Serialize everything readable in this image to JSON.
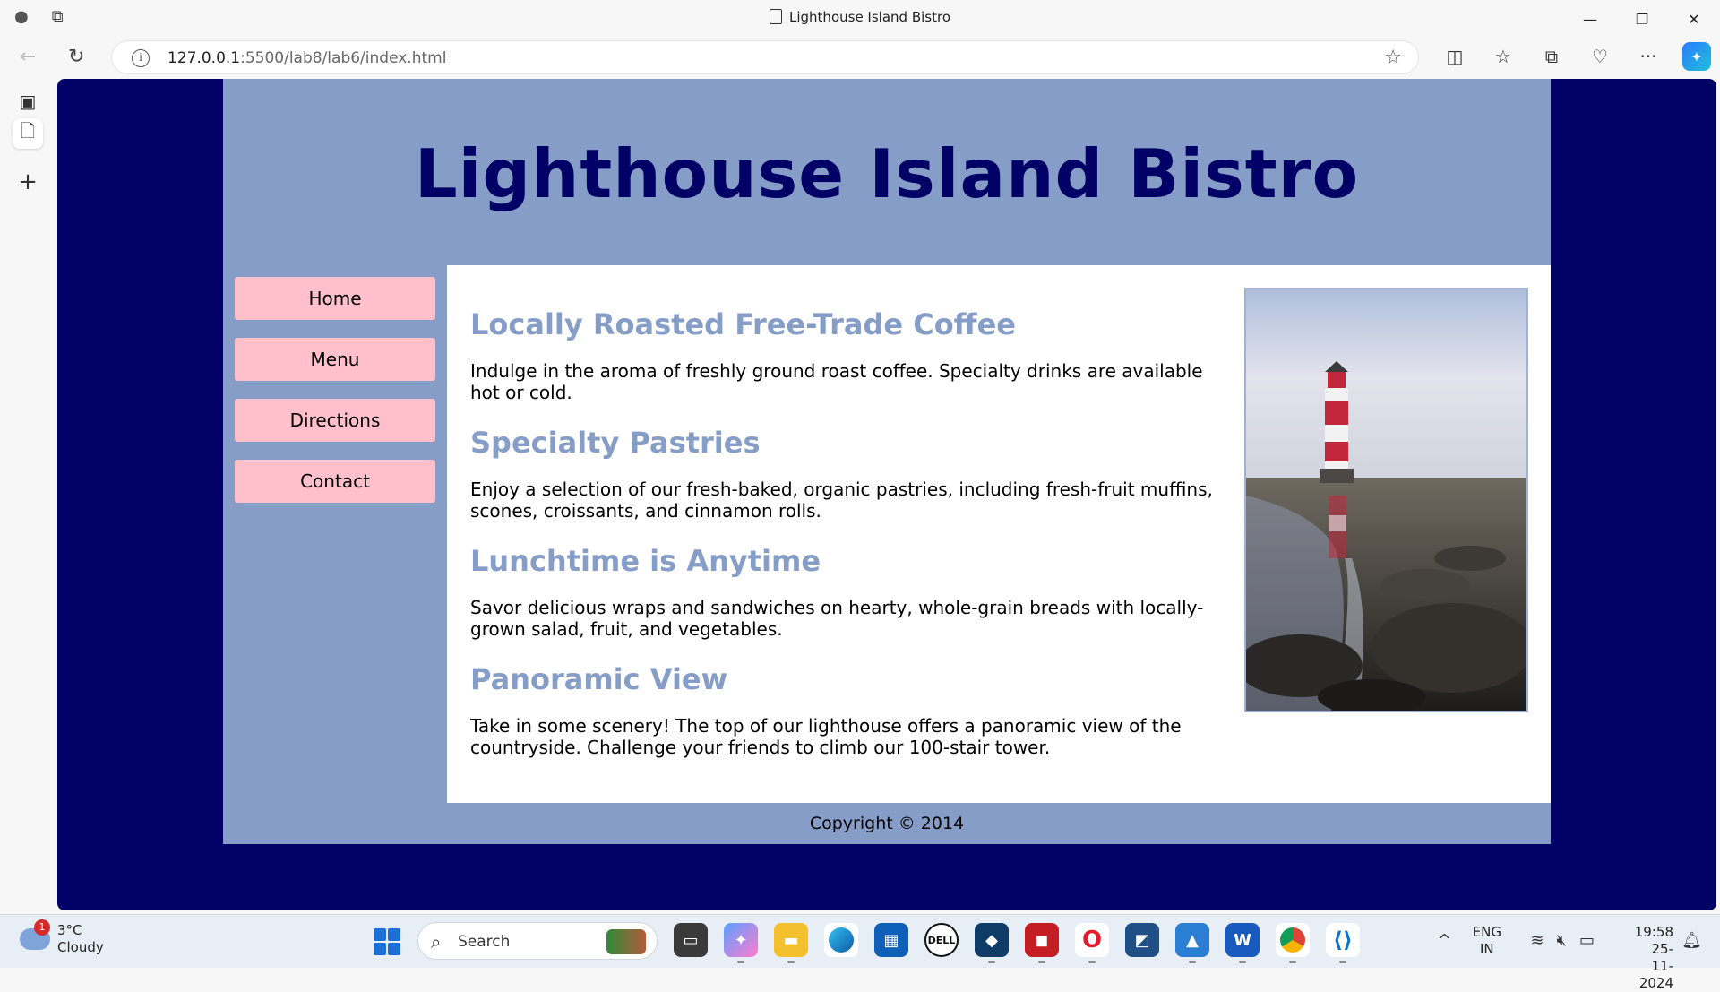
{
  "browser": {
    "tab_title": "Lighthouse Island Bistro",
    "url_host": "127.0.0.1",
    "url_rest": ":5500/lab8/lab6/index.html"
  },
  "site": {
    "title": "Lighthouse Island Bistro",
    "nav": [
      "Home",
      "Menu",
      "Directions",
      "Contact"
    ],
    "sections": [
      {
        "heading": "Locally Roasted Free-Trade Coffee",
        "text": "Indulge in the aroma of freshly ground roast coffee. Specialty drinks are available hot or cold."
      },
      {
        "heading": "Specialty Pastries",
        "text": "Enjoy a selection of our fresh-baked, organic pastries, including fresh-fruit muffins, scones, croissants, and cinnamon rolls."
      },
      {
        "heading": "Lunchtime is Anytime",
        "text": "Savor delicious wraps and sandwiches on hearty, whole-grain breads with locally-grown salad, fruit, and vegetables."
      },
      {
        "heading": "Panoramic View",
        "text": "Take in some scenery! The top of our lighthouse offers a panoramic view of the countryside. Challenge your friends to climb our 100-stair tower."
      }
    ],
    "footer": "Copyright © 2014",
    "colors": {
      "background": "#000066",
      "wrapper": "#869dc7",
      "nav_button": "#ffc0cb",
      "heading": "#869dc7"
    }
  },
  "taskbar": {
    "weather_temp": "3°C",
    "weather_desc": "Cloudy",
    "weather_badge": "1",
    "search_label": "Search",
    "lang_line1": "ENG",
    "lang_line2": "IN",
    "time": "19:58",
    "date": "25-11-2024"
  }
}
